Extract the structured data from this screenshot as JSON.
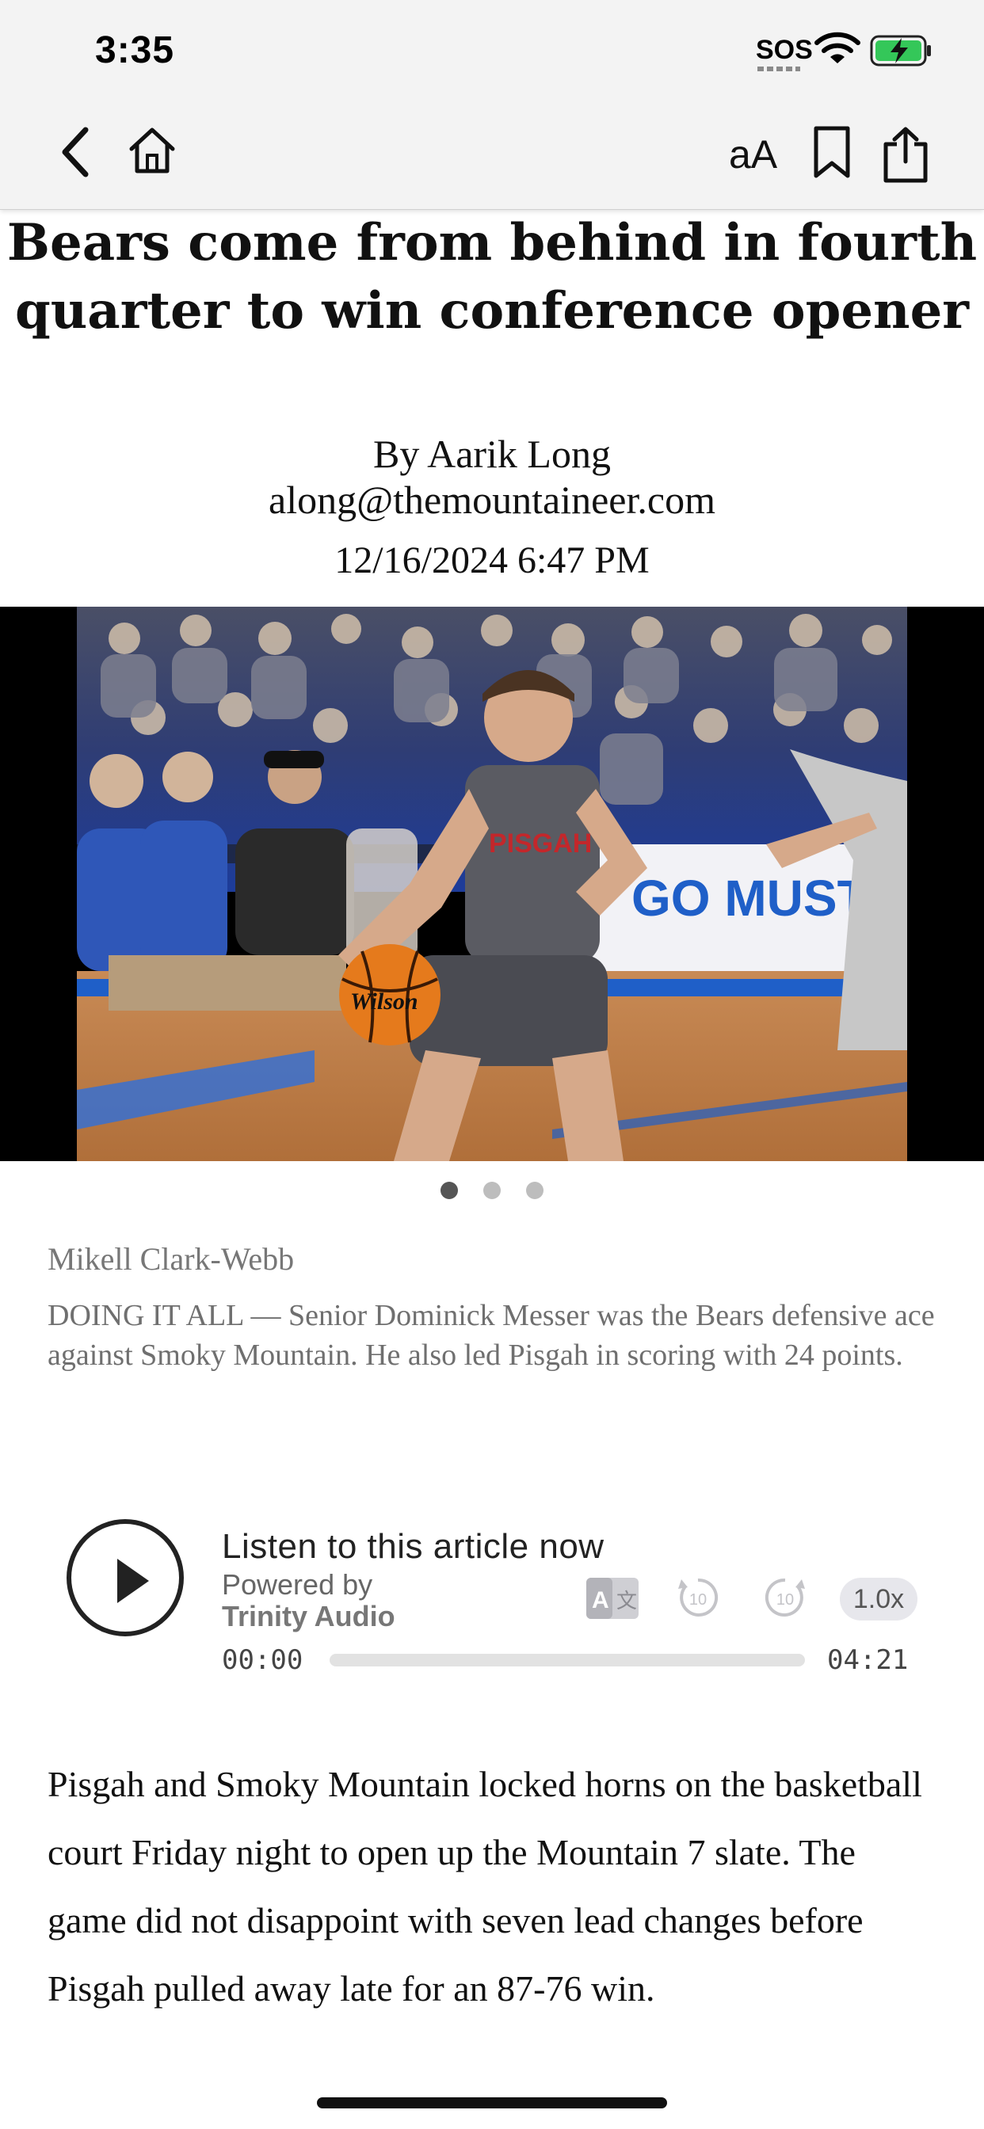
{
  "status_bar": {
    "time": "3:35",
    "sos": "SOS"
  },
  "toolbar": {
    "text_size": "aA",
    "icons": [
      "back-chevron-icon",
      "home-icon",
      "bookmark-icon",
      "share-icon"
    ]
  },
  "article": {
    "title": "Bears come from behind in fourth quarter to win conference opener",
    "author": "By Aarik Long",
    "email": "along@themountaineer.com",
    "date": "12/16/2024 6:47 PM"
  },
  "gallery": {
    "current_index": 1,
    "total": 3
  },
  "photo": {
    "banner_text": "GO MUSTANGS!",
    "jersey_text": "PISGAH",
    "ball_text": "Wilson"
  },
  "photo_credit": "Mikell Clark-Webb",
  "caption": "DOING IT ALL — Senior Dominick Messer was the Bears defensive ace against Smoky Mountain. He also led Pisgah in scoring with 24 points.",
  "audio_player": {
    "title": "Listen to this article now",
    "powered_by": "Powered by",
    "provider": "Trinity Audio",
    "rewind_label": "10",
    "forward_label": "10",
    "speed": "1.0x",
    "current_time": "00:00",
    "duration": "04:21",
    "progress": 0
  },
  "body": "Pisgah and Smoky Mountain locked horns on the basketball court Friday night to open up the Mountain 7 slate. The game did not disappoint with seven lead changes before Pisgah pulled away late for an 87-76 win.",
  "colors": {
    "toolbar_bg": "#f3f3f3",
    "battery_green": "#34c759",
    "court_blue": "#1f5fc8"
  }
}
